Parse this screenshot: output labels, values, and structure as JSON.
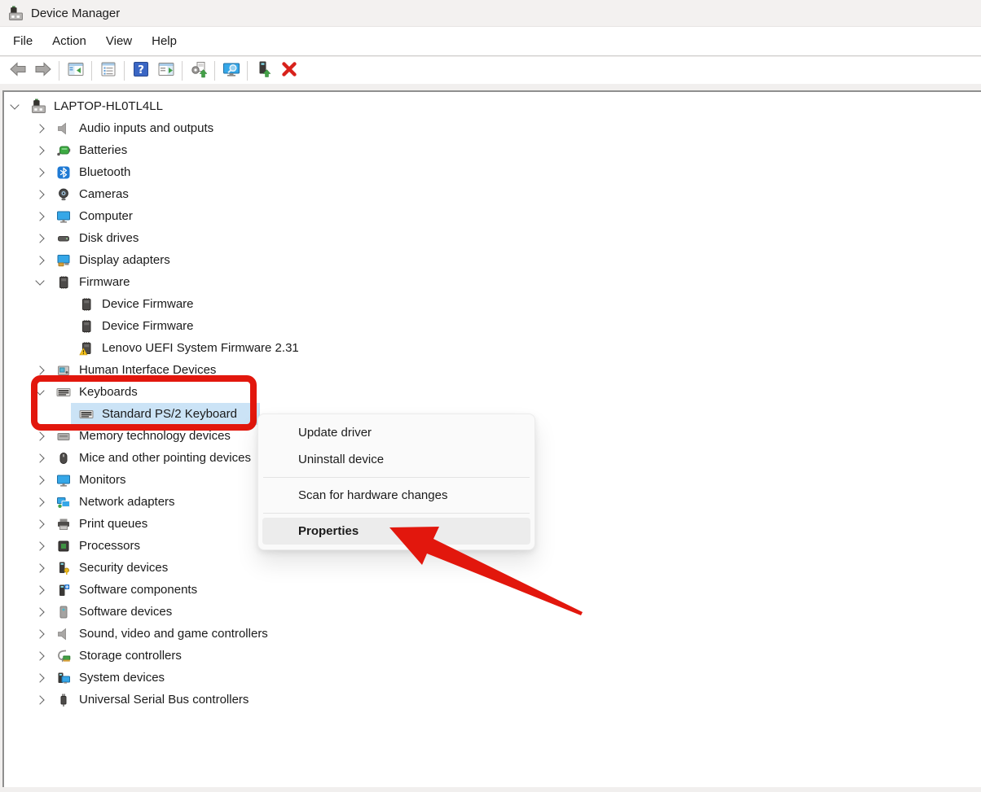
{
  "titlebar": {
    "title": "Device Manager",
    "icon": "device-manager-icon"
  },
  "menubar": {
    "items": [
      {
        "label": "File"
      },
      {
        "label": "Action"
      },
      {
        "label": "View"
      },
      {
        "label": "Help"
      }
    ]
  },
  "toolbar": {
    "buttons": [
      {
        "name": "back-button",
        "icon": "back-arrow-icon"
      },
      {
        "name": "forward-button",
        "icon": "forward-arrow-icon"
      },
      {
        "separator": true
      },
      {
        "name": "show-console-tree-button",
        "icon": "console-tree-icon"
      },
      {
        "separator": true
      },
      {
        "name": "properties-button",
        "icon": "properties-window-icon"
      },
      {
        "separator": true
      },
      {
        "name": "help-button",
        "icon": "help-icon"
      },
      {
        "name": "show-action-pane-button",
        "icon": "action-pane-icon"
      },
      {
        "separator": true
      },
      {
        "name": "update-driver-button",
        "icon": "driver-update-icon"
      },
      {
        "separator": true
      },
      {
        "name": "scan-hardware-changes-button",
        "icon": "scan-hardware-icon"
      },
      {
        "separator": true
      },
      {
        "name": "enable-device-button",
        "icon": "device-enable-icon"
      },
      {
        "name": "uninstall-device-button",
        "icon": "uninstall-x-icon"
      }
    ]
  },
  "tree": {
    "items": [
      {
        "label": "LAPTOP-HL0TL4LL",
        "icon": "device-manager-icon",
        "level": 0,
        "state": "expanded"
      },
      {
        "label": "Audio inputs and outputs",
        "icon": "speaker-icon",
        "level": 1,
        "state": "collapsed"
      },
      {
        "label": "Batteries",
        "icon": "battery-icon",
        "level": 1,
        "state": "collapsed"
      },
      {
        "label": "Bluetooth",
        "icon": "bluetooth-icon",
        "level": 1,
        "state": "collapsed"
      },
      {
        "label": "Cameras",
        "icon": "camera-icon",
        "level": 1,
        "state": "collapsed"
      },
      {
        "label": "Computer",
        "icon": "monitor-icon",
        "level": 1,
        "state": "collapsed"
      },
      {
        "label": "Disk drives",
        "icon": "disk-icon",
        "level": 1,
        "state": "collapsed"
      },
      {
        "label": "Display adapters",
        "icon": "display-adapter-icon",
        "level": 1,
        "state": "collapsed"
      },
      {
        "label": "Firmware",
        "icon": "chip-icon",
        "level": 1,
        "state": "expanded"
      },
      {
        "label": "Device Firmware",
        "icon": "chip-icon",
        "level": 2,
        "state": "none"
      },
      {
        "label": "Device Firmware",
        "icon": "chip-icon",
        "level": 2,
        "state": "none"
      },
      {
        "label": "Lenovo UEFI System Firmware 2.31",
        "icon": "chip-warning-icon",
        "level": 2,
        "state": "none"
      },
      {
        "label": "Human Interface Devices",
        "icon": "hid-icon",
        "level": 1,
        "state": "collapsed"
      },
      {
        "label": "Keyboards",
        "icon": "keyboard-icon",
        "level": 1,
        "state": "expanded"
      },
      {
        "label": "Standard PS/2 Keyboard",
        "icon": "keyboard-icon",
        "level": 2,
        "state": "none",
        "selected": true
      },
      {
        "label": "Memory technology devices",
        "icon": "memory-icon",
        "level": 1,
        "state": "collapsed"
      },
      {
        "label": "Mice and other pointing devices",
        "icon": "mouse-icon",
        "level": 1,
        "state": "collapsed"
      },
      {
        "label": "Monitors",
        "icon": "monitor-icon",
        "level": 1,
        "state": "collapsed"
      },
      {
        "label": "Network adapters",
        "icon": "network-icon",
        "level": 1,
        "state": "collapsed"
      },
      {
        "label": "Print queues",
        "icon": "printer-icon",
        "level": 1,
        "state": "collapsed"
      },
      {
        "label": "Processors",
        "icon": "processor-icon",
        "level": 1,
        "state": "collapsed"
      },
      {
        "label": "Security devices",
        "icon": "security-key-icon",
        "level": 1,
        "state": "collapsed"
      },
      {
        "label": "Software components",
        "icon": "software-component-icon",
        "level": 1,
        "state": "collapsed"
      },
      {
        "label": "Software devices",
        "icon": "software-device-icon",
        "level": 1,
        "state": "collapsed"
      },
      {
        "label": "Sound, video and game controllers",
        "icon": "speaker-icon",
        "level": 1,
        "state": "collapsed"
      },
      {
        "label": "Storage controllers",
        "icon": "storage-controller-icon",
        "level": 1,
        "state": "collapsed"
      },
      {
        "label": "System devices",
        "icon": "system-device-icon",
        "level": 1,
        "state": "collapsed"
      },
      {
        "label": "Universal Serial Bus controllers",
        "icon": "usb-icon",
        "level": 1,
        "state": "collapsed"
      }
    ]
  },
  "context_menu": {
    "items": [
      {
        "label": "Update driver"
      },
      {
        "label": "Uninstall device"
      },
      {
        "separator": true
      },
      {
        "label": "Scan for hardware changes"
      },
      {
        "separator": true
      },
      {
        "label": "Properties",
        "emphasized": true,
        "highlighted": true
      }
    ]
  },
  "annotations": {
    "red_color": "#e2170d",
    "box_target": "Keyboards",
    "arrow_target": "Properties"
  },
  "colors": {
    "selection": "#cbe3f6"
  }
}
